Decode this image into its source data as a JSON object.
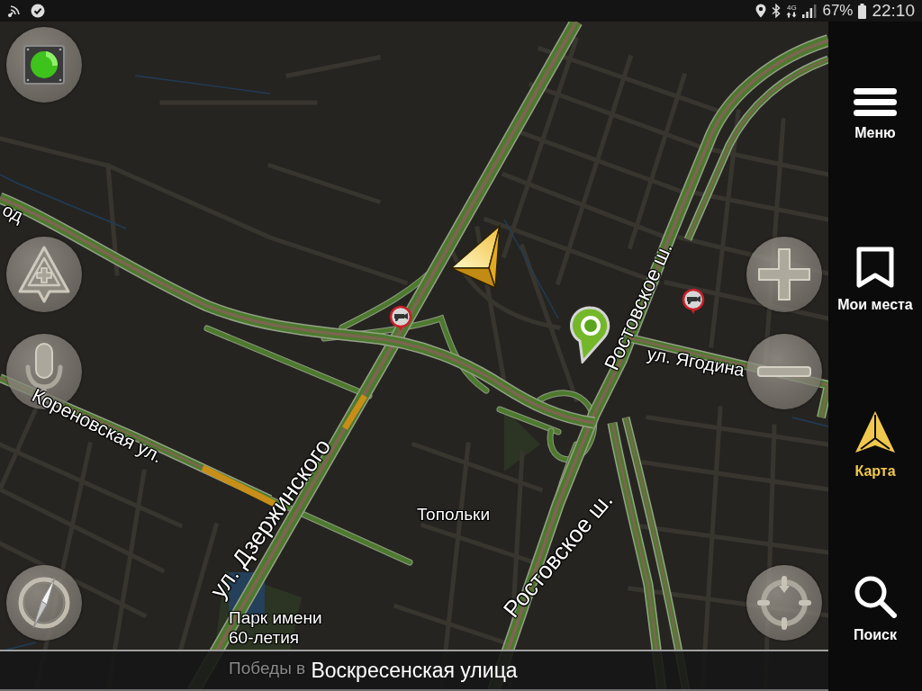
{
  "status_bar": {
    "network": "4G",
    "battery": "67%",
    "time": "22:10"
  },
  "map": {
    "street_labels": [
      "од",
      "ул. Дзержинского",
      "Ростовское ш.",
      "Ростовское ш.",
      "ул. Ягодина",
      "Кореновская ул."
    ],
    "place_label": "Топольки",
    "park_label": {
      "lines": [
        "Парк имени",
        "60-летия"
      ],
      "covered_line": "Победы в"
    }
  },
  "current_street": "Воскресенская улица",
  "sidebar": {
    "items": [
      {
        "kind": "menu",
        "label": "Меню",
        "selected": false
      },
      {
        "kind": "places",
        "label": "Мои места",
        "selected": false
      },
      {
        "kind": "map",
        "label": "Карта",
        "selected": true
      },
      {
        "kind": "search",
        "label": "Поиск",
        "selected": false
      }
    ]
  }
}
